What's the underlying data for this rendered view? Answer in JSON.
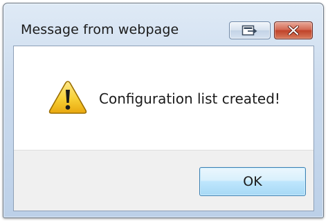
{
  "window": {
    "title": "Message from webpage",
    "caption_buttons": {
      "restore_icon": "restore-icon",
      "close_icon": "close-icon"
    }
  },
  "dialog": {
    "icon": "warning-icon",
    "message": "Configuration list created!",
    "ok_label": "OK"
  },
  "colors": {
    "warning_fill": "#f5c92b",
    "close_button": "#c8452c",
    "ok_button_border": "#3c7fb1"
  }
}
